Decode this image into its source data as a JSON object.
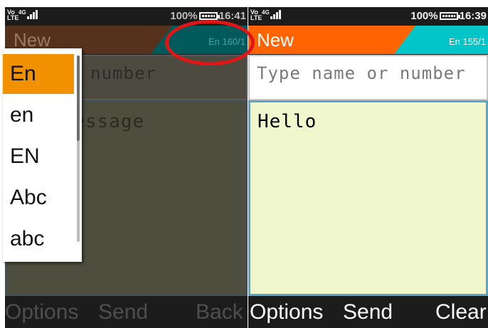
{
  "left": {
    "status": {
      "network": "Vo LTE 4G",
      "battery": "100%",
      "time": "16:41"
    },
    "header": {
      "title": "New",
      "counter": "En 160/1"
    },
    "to_field": {
      "text": "ame or number"
    },
    "message": {
      "text": "ext message"
    },
    "softkeys": {
      "left": "Options",
      "center": "Send",
      "right": "Back"
    },
    "input_mode_menu": {
      "items": [
        "En",
        "en",
        "EN",
        "Abc",
        "abc"
      ],
      "selected": "En"
    }
  },
  "right": {
    "status": {
      "network": "Vo LTE 4G",
      "battery": "100%",
      "time": "16:39"
    },
    "header": {
      "title": "New",
      "counter": "En 155/1"
    },
    "to_field": {
      "placeholder": "Type name or number"
    },
    "message": {
      "text": "Hello"
    },
    "softkeys": {
      "left": "Options",
      "center": "Send",
      "right": "Clear"
    }
  },
  "colors": {
    "accent_orange": "#ff6400",
    "accent_cyan": "#00c6c9",
    "message_bg": "#f1f7cd",
    "selection_orange": "#f29100",
    "annotation_red": "#e01616"
  },
  "icons": [
    "volte-icon",
    "signal-icon",
    "battery-icon"
  ]
}
